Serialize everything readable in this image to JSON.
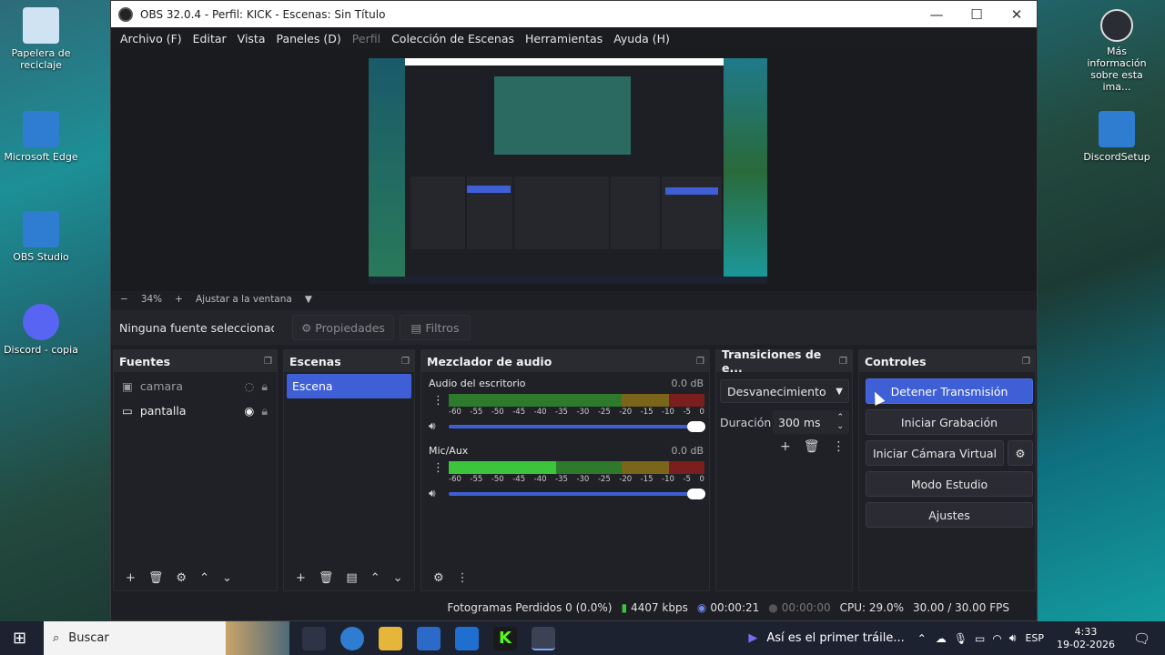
{
  "desktop": {
    "icons": [
      {
        "label": "Papelera de reciclaje",
        "name": "recycle-bin-icon",
        "color": "#cfe3f2"
      },
      {
        "label": "Microsoft Edge",
        "name": "edge-shortcut-icon",
        "color": "#2f7dd1"
      },
      {
        "label": "OBS Studio",
        "name": "obs-shortcut-icon",
        "color": "#2f7dd1"
      },
      {
        "label": "Discord - copia",
        "name": "discord-icon",
        "color": "#5865f2"
      }
    ],
    "right_icons": [
      {
        "label": "Más información sobre esta ima...",
        "name": "info-icon"
      },
      {
        "label": "DiscordSetup",
        "name": "setup-icon"
      }
    ]
  },
  "window": {
    "title": "OBS 32.0.4 - Perfil: KICK - Escenas: Sin Título",
    "minimize": "—",
    "maximize": "☐",
    "close": "✕"
  },
  "menu": [
    "Archivo (F)",
    "Editar",
    "Vista",
    "Paneles (D)",
    "Perfil",
    "Colección de Escenas",
    "Herramientas",
    "Ayuda (H)"
  ],
  "zoom": {
    "minus": "−",
    "value": "34%",
    "plus": "+",
    "fit": "Ajustar a la ventana",
    "caret": "▼"
  },
  "source_bar": {
    "none": "Ninguna fuente seleccionada",
    "props": "Propiedades",
    "filters": "Filtros"
  },
  "sources": {
    "title": "Fuentes",
    "items": [
      {
        "label": "camara",
        "eye": "hidden"
      },
      {
        "label": "pantalla",
        "eye": "visible"
      }
    ]
  },
  "scenes": {
    "title": "Escenas",
    "items": [
      "Escena"
    ]
  },
  "mixer": {
    "title": "Mezclador de audio",
    "channels": [
      {
        "name": "Audio del escritorio",
        "db": "0.0 dB",
        "level": 0
      },
      {
        "name": "Mic/Aux",
        "db": "0.0 dB",
        "level": 0.42
      }
    ],
    "ticks": [
      "-60",
      "-55",
      "-50",
      "-45",
      "-40",
      "-35",
      "-30",
      "-25",
      "-20",
      "-15",
      "-10",
      "-5",
      "0"
    ]
  },
  "transitions": {
    "title": "Transiciones de e...",
    "selected": "Desvanecimiento",
    "duration_label": "Duración",
    "duration": "300 ms"
  },
  "controls": {
    "title": "Controles",
    "stop_stream": "Detener Transmisión",
    "start_record": "Iniciar Grabación",
    "virtual_cam": "Iniciar Cámara Virtual",
    "studio": "Modo Estudio",
    "settings": "Ajustes"
  },
  "status": {
    "dropped": "Fotogramas Perdidos 0 (0.0%)",
    "bitrate": "4407 kbps",
    "stream_time": "00:00:21",
    "rec_time": "00:00:00",
    "cpu": "CPU: 29.0%",
    "fps": "30.00 / 30.00 FPS"
  },
  "taskbar": {
    "search": "Buscar",
    "media": "Así es el primer tráile...",
    "lang": "ESP",
    "time": "4:33",
    "date": "19-02-2026"
  },
  "colors": {
    "accent": "#3f5fd6",
    "green": "#3cc43c",
    "yellow": "#c2a11d",
    "red": "#b42727"
  }
}
